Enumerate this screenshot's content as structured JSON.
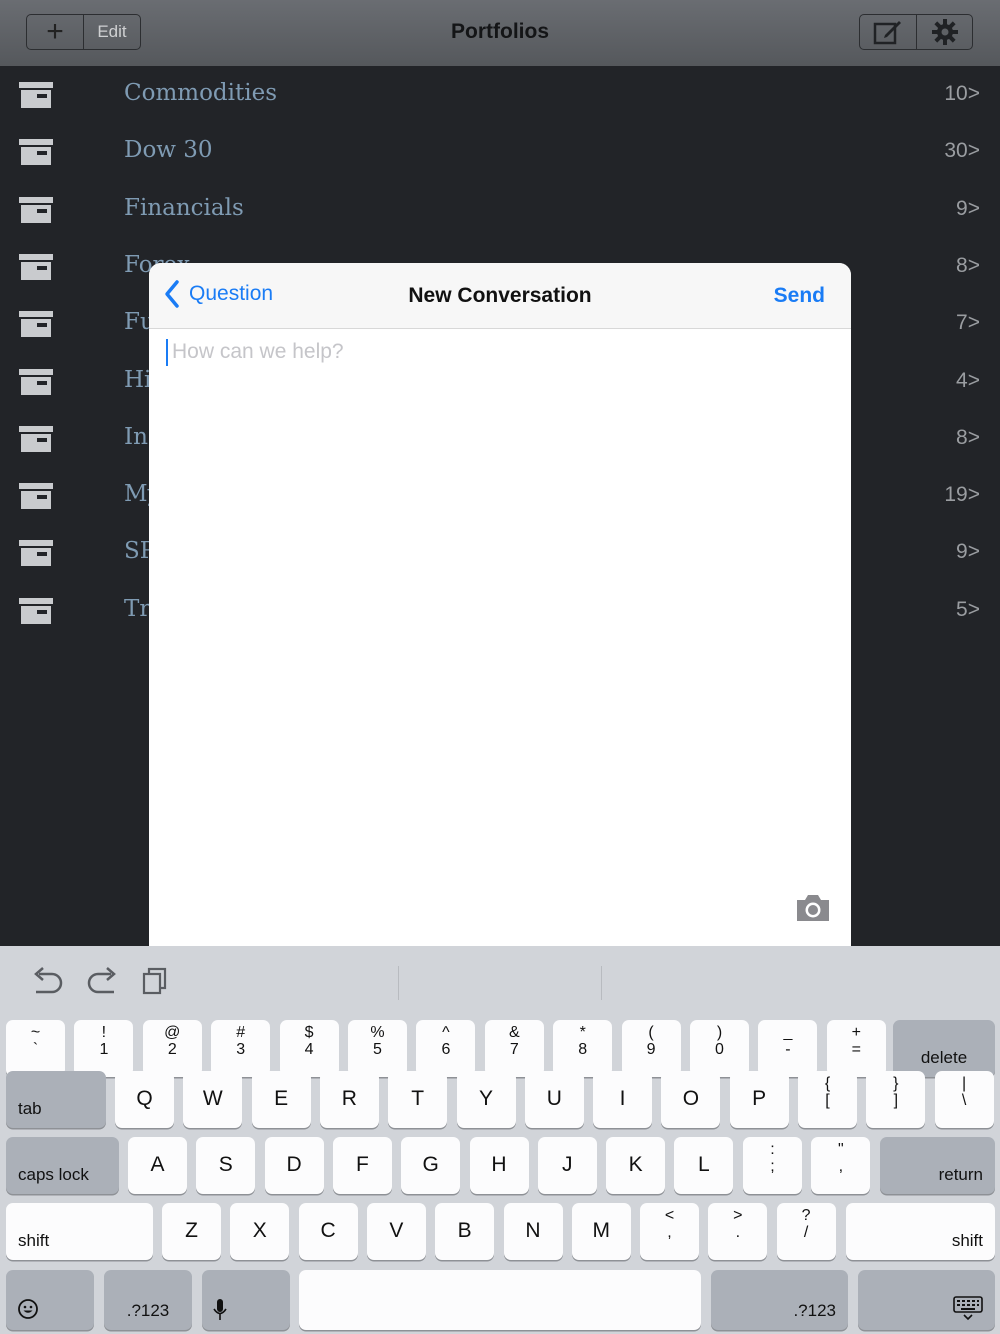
{
  "toolbar": {
    "add_label": "+",
    "edit_label": "Edit",
    "title": "Portfolios"
  },
  "portfolios": [
    {
      "name": "Commodities",
      "count": "10>"
    },
    {
      "name": "Dow 30",
      "count": "30>"
    },
    {
      "name": "Financials",
      "count": "9>"
    },
    {
      "name": "Forex",
      "count": "8>"
    },
    {
      "name": "Futures",
      "count": "7>"
    },
    {
      "name": "High",
      "count": "4>"
    },
    {
      "name": "Index",
      "count": "8>"
    },
    {
      "name": "My",
      "count": "19>"
    },
    {
      "name": "SP",
      "count": "9>"
    },
    {
      "name": "Tr",
      "count": "5>"
    }
  ],
  "modal": {
    "back_label": "Question",
    "title": "New Conversation",
    "send_label": "Send",
    "placeholder": "How can we help?"
  },
  "keyboard": {
    "row1": [
      {
        "t": "~",
        "b": "`"
      },
      {
        "t": "!",
        "b": "1"
      },
      {
        "t": "@",
        "b": "2"
      },
      {
        "t": "#",
        "b": "3"
      },
      {
        "t": "$",
        "b": "4"
      },
      {
        "t": "%",
        "b": "5"
      },
      {
        "t": "^",
        "b": "6"
      },
      {
        "t": "&",
        "b": "7"
      },
      {
        "t": "*",
        "b": "8"
      },
      {
        "t": "(",
        "b": "9"
      },
      {
        "t": ")",
        "b": "0"
      },
      {
        "t": "_",
        "b": "-"
      },
      {
        "t": "+",
        "b": "="
      }
    ],
    "delete": "delete",
    "tab": "tab",
    "row2": [
      "Q",
      "W",
      "E",
      "R",
      "T",
      "Y",
      "U",
      "I",
      "O",
      "P"
    ],
    "row2_sym": [
      {
        "t": "{",
        "b": "["
      },
      {
        "t": "}",
        "b": "]"
      },
      {
        "t": "|",
        "b": "\\"
      }
    ],
    "caps": "caps lock",
    "row3": [
      "A",
      "S",
      "D",
      "F",
      "G",
      "H",
      "J",
      "K",
      "L"
    ],
    "row3_sym": [
      {
        "t": ":",
        "b": ";"
      },
      {
        "t": "\"",
        "b": ","
      }
    ],
    "return": "return",
    "shift": "shift",
    "row4": [
      "Z",
      "X",
      "C",
      "V",
      "B",
      "N",
      "M"
    ],
    "row4_sym": [
      {
        "t": "<",
        "b": ","
      },
      {
        "t": ">",
        "b": "."
      },
      {
        "t": "?",
        "b": "/"
      }
    ],
    "numbers": ".?123"
  }
}
